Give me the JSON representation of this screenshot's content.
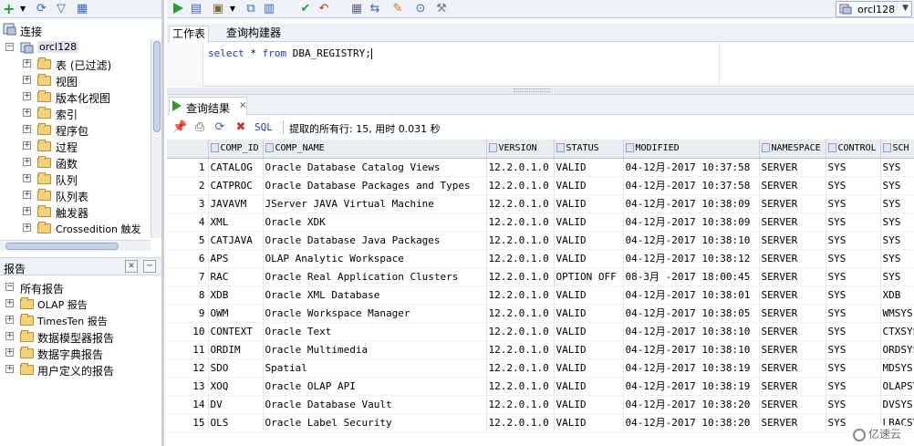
{
  "left_panel": {
    "connections": {
      "title": "连接",
      "connection_name": "orcl128",
      "items": [
        {
          "label": "表 (已过滤)"
        },
        {
          "label": "视图"
        },
        {
          "label": "版本化视图"
        },
        {
          "label": "索引"
        },
        {
          "label": "程序包"
        },
        {
          "label": "过程"
        },
        {
          "label": "函数"
        },
        {
          "label": "队列"
        },
        {
          "label": "队列表"
        },
        {
          "label": "触发器"
        },
        {
          "label": "Crossedition 触发"
        }
      ]
    },
    "reports": {
      "title": "报告",
      "root": "所有报告",
      "items": [
        {
          "label": "OLAP 报告"
        },
        {
          "label": "TimesTen 报告"
        },
        {
          "label": "数据模型器报告"
        },
        {
          "label": "数据字典报告"
        },
        {
          "label": "用户定义的报告"
        }
      ]
    }
  },
  "toolbar": {
    "connection_selector": "orcl128"
  },
  "worksheet": {
    "tabs": [
      {
        "label": "工作表"
      },
      {
        "label": "查询构建器"
      }
    ],
    "sql_keyword1": "select",
    "sql_star": " * ",
    "sql_keyword2": "from",
    "sql_rest": " DBA_REGISTRY;"
  },
  "results": {
    "tab_label": "查询结果",
    "close": "×",
    "sql_label": "SQL",
    "status": "提取的所有行: 15, 用时 0.031 秒",
    "columns": [
      "COMP_ID",
      "COMP_NAME",
      "VERSION",
      "STATUS",
      "MODIFIED",
      "NAMESPACE",
      "CONTROL",
      "SCH"
    ],
    "rows": [
      [
        "1",
        "CATALOG",
        "Oracle Database Catalog Views",
        "12.2.0.1.0",
        "VALID",
        "04-12月-2017 10:37:58",
        "SERVER",
        "SYS",
        "SYS"
      ],
      [
        "2",
        "CATPROC",
        "Oracle Database Packages and Types",
        "12.2.0.1.0",
        "VALID",
        "04-12月-2017 10:37:58",
        "SERVER",
        "SYS",
        "SYS"
      ],
      [
        "3",
        "JAVAVM",
        "JServer JAVA Virtual Machine",
        "12.2.0.1.0",
        "VALID",
        "04-12月-2017 10:38:09",
        "SERVER",
        "SYS",
        "SYS"
      ],
      [
        "4",
        "XML",
        "Oracle XDK",
        "12.2.0.1.0",
        "VALID",
        "04-12月-2017 10:38:09",
        "SERVER",
        "SYS",
        "SYS"
      ],
      [
        "5",
        "CATJAVA",
        "Oracle Database Java Packages",
        "12.2.0.1.0",
        "VALID",
        "04-12月-2017 10:38:10",
        "SERVER",
        "SYS",
        "SYS"
      ],
      [
        "6",
        "APS",
        "OLAP Analytic Workspace",
        "12.2.0.1.0",
        "VALID",
        "04-12月-2017 10:38:12",
        "SERVER",
        "SYS",
        "SYS"
      ],
      [
        "7",
        "RAC",
        "Oracle Real Application Clusters",
        "12.2.0.1.0",
        "OPTION OFF",
        "08-3月 -2017 18:00:45",
        "SERVER",
        "SYS",
        "SYS"
      ],
      [
        "8",
        "XDB",
        "Oracle XML Database",
        "12.2.0.1.0",
        "VALID",
        "04-12月-2017 10:38:01",
        "SERVER",
        "SYS",
        "XDB"
      ],
      [
        "9",
        "OWM",
        "Oracle Workspace Manager",
        "12.2.0.1.0",
        "VALID",
        "04-12月-2017 10:38:05",
        "SERVER",
        "SYS",
        "WMSYS"
      ],
      [
        "10",
        "CONTEXT",
        "Oracle Text",
        "12.2.0.1.0",
        "VALID",
        "04-12月-2017 10:38:10",
        "SERVER",
        "SYS",
        "CTXSYS"
      ],
      [
        "11",
        "ORDIM",
        "Oracle Multimedia",
        "12.2.0.1.0",
        "VALID",
        "04-12月-2017 10:38:10",
        "SERVER",
        "SYS",
        "ORDSYS"
      ],
      [
        "12",
        "SDO",
        "Spatial",
        "12.2.0.1.0",
        "VALID",
        "04-12月-2017 10:38:19",
        "SERVER",
        "SYS",
        "MDSYS"
      ],
      [
        "13",
        "XOQ",
        "Oracle OLAP API",
        "12.2.0.1.0",
        "VALID",
        "04-12月-2017 10:38:19",
        "SERVER",
        "SYS",
        "OLAPSYS"
      ],
      [
        "14",
        "DV",
        "Oracle Database Vault",
        "12.2.0.1.0",
        "VALID",
        "04-12月-2017 10:38:20",
        "SERVER",
        "SYS",
        "DVSYS"
      ],
      [
        "15",
        "OLS",
        "Oracle Label Security",
        "12.2.0.1.0",
        "VALID",
        "04-12月-2017 10:38:20",
        "SERVER",
        "SYS",
        "LBACSYS"
      ]
    ]
  },
  "watermark": "亿速云",
  "colors": {
    "run_green": "#2f9a31",
    "keyword_blue": "#1a3ab0",
    "folder_yellow": "#f4d27a",
    "toolbar_bg": "#eef1f6"
  }
}
